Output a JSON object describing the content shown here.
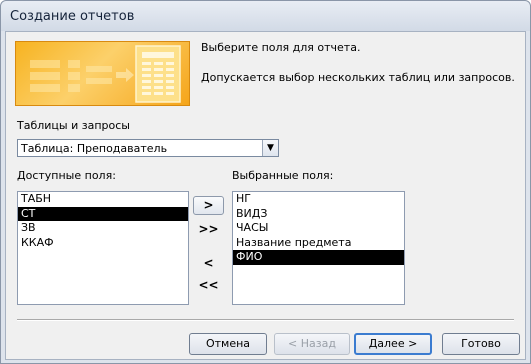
{
  "window": {
    "title": "Создание отчетов"
  },
  "header": {
    "line1": "Выберите поля для отчета.",
    "line2": "Допускается выбор нескольких таблиц или запросов."
  },
  "source": {
    "label": "Таблицы и запросы",
    "selected": "Таблица: Преподаватель"
  },
  "available": {
    "label": "Доступные поля:",
    "items": [
      "ТАБН",
      "СТ",
      "ЗВ",
      "ККАФ"
    ],
    "selected_index": 1
  },
  "chosen": {
    "label": "Выбранные поля:",
    "items": [
      "НГ",
      "ВИДЗ",
      "ЧАСЫ",
      "Название предмета",
      "ФИО"
    ],
    "selected_index": 4
  },
  "move_buttons": {
    "add_one": ">",
    "add_all": ">>",
    "remove_one": "<",
    "remove_all": "<<"
  },
  "footer": {
    "cancel": "Отмена",
    "back": "< Назад",
    "next": "Далее >",
    "finish": "Готово"
  }
}
